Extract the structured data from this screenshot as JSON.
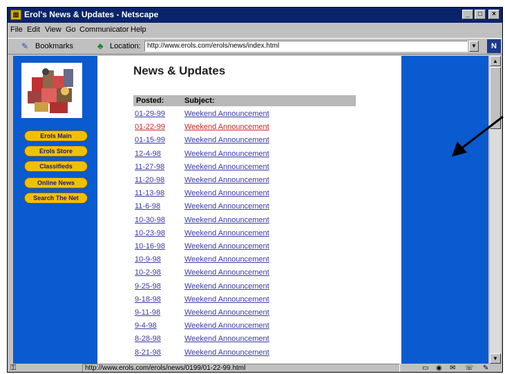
{
  "window": {
    "title": "Erol's News & Updates - Netscape",
    "buttons": {
      "minimize": "_",
      "maximize": "□",
      "close": "×"
    }
  },
  "menu": [
    "File",
    "Edit",
    "View",
    "Go",
    "Communicator",
    "Help"
  ],
  "toolbar": {
    "bookmarks_label": "Bookmarks",
    "location_label": "Location:",
    "url": "http://www.erols.com/erols/news/index.html",
    "netscape_logo": "N"
  },
  "sidebar": {
    "logo_icon": "erols-logo-collage",
    "buttons": [
      "Erols Main",
      "Erols Store",
      "Classifieds",
      "Online News",
      "Search The Net"
    ]
  },
  "page": {
    "title": "News & Updates",
    "columns": [
      "Posted:",
      "Subject:"
    ],
    "rows": [
      {
        "date": "01-29-99",
        "subject": "Weekend Announcement",
        "visited": false
      },
      {
        "date": "01-22-99",
        "subject": "Weekend Announcement",
        "visited": true
      },
      {
        "date": "01-15-99",
        "subject": "Weekend Announcement",
        "visited": false
      },
      {
        "date": "12-4-98",
        "subject": "Weekend Announcement",
        "visited": false
      },
      {
        "date": "11-27-98",
        "subject": "Weekend Announcement",
        "visited": false
      },
      {
        "date": "11-20-98",
        "subject": "Weekend Announcement",
        "visited": false
      },
      {
        "date": "11-13-98",
        "subject": "Weekend Announcement",
        "visited": false
      },
      {
        "date": "11-6-98",
        "subject": "Weekend Announcement",
        "visited": false
      },
      {
        "date": "10-30-98",
        "subject": "Weekend Announcement",
        "visited": false
      },
      {
        "date": "10-23-98",
        "subject": "Weekend Announcement",
        "visited": false
      },
      {
        "date": "10-16-98",
        "subject": "Weekend Announcement",
        "visited": false
      },
      {
        "date": "10-9-98",
        "subject": "Weekend Announcement",
        "visited": false
      },
      {
        "date": "10-2-98",
        "subject": "Weekend Announcement",
        "visited": false
      },
      {
        "date": "9-25-98",
        "subject": "Weekend Announcement",
        "visited": false
      },
      {
        "date": "9-18-98",
        "subject": "Weekend Announcement",
        "visited": false
      },
      {
        "date": "9-11-98",
        "subject": "Weekend Announcement",
        "visited": false
      },
      {
        "date": "9-4-98",
        "subject": "Weekend Announcement",
        "visited": false
      },
      {
        "date": "8-28-98",
        "subject": "Weekend Announcement",
        "visited": false
      },
      {
        "date": "8-21-98",
        "subject": "Weekend Announcement",
        "visited": false
      }
    ]
  },
  "status": {
    "text": "http://www.erols.com/erols/news/0199/01-22-99.html"
  },
  "colors": {
    "titlebar": "#0a246a",
    "page_background": "#0a5ad0",
    "nav_button": "#f0c000",
    "link": "#3a3aa8",
    "visited_link": "#c82828"
  }
}
